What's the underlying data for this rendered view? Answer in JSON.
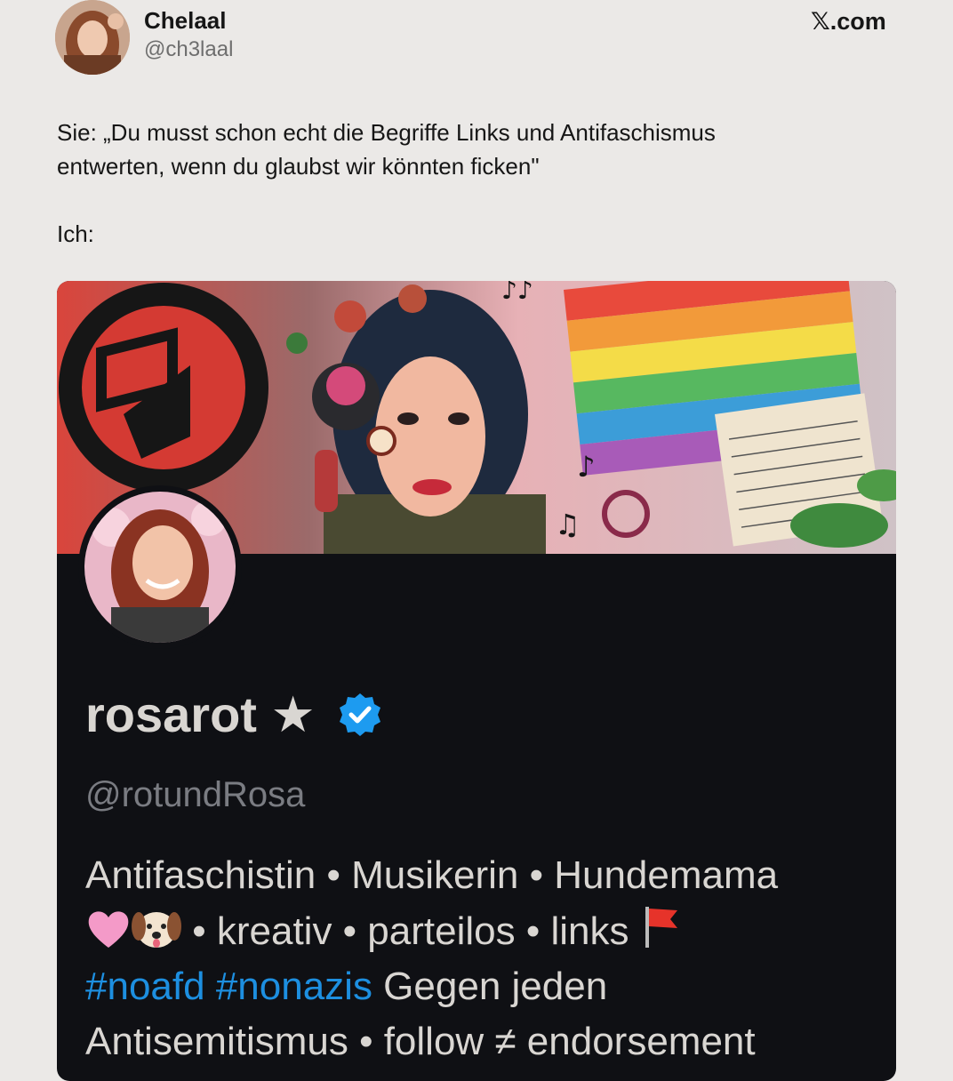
{
  "tweet": {
    "author_name": "Chelaal",
    "author_handle": "@ch3laal",
    "source": "𝕏.com",
    "text": "Sie: „Du musst schon echt die Begriffe Links und Antifaschismus\nentwerten, wenn du glaubst wir könnten ficken\"\n\nIch:"
  },
  "profile_card": {
    "display_name": "rosarot ★",
    "handle": "@rotundRosa",
    "bio_line1": "Antifaschistin • Musikerin • Hundemama",
    "bio_line2_text": " • kreativ • parteilos • links ",
    "hashtag1": "#noafd",
    "hashtag2": "#nonazis",
    "bio_line3_text": " Gegen jeden",
    "bio_line4": "Antisemitismus • follow ≠ endorsement",
    "verified_icon": "verified-badge-icon",
    "emoji_icons": [
      "pink-heart-icon",
      "dog-face-icon",
      "red-flag-icon"
    ]
  },
  "colors": {
    "page_bg": "#ebe9e7",
    "card_bg": "#0f1014",
    "hashtag": "#1d8fe0",
    "verified": "#1d9bf0"
  }
}
